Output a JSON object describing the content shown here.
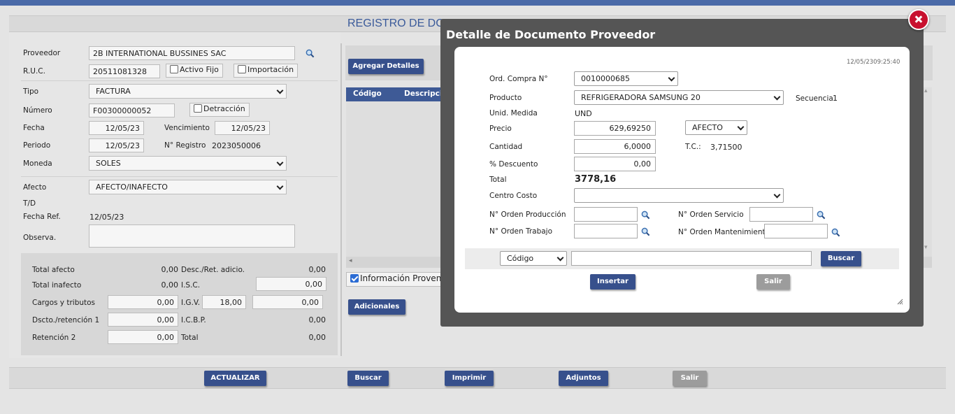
{
  "page": {
    "title": "REGISTRO DE DOCUMENTOS PROVEEDOR",
    "title_visible": "REGISTRO DE DC"
  },
  "form": {
    "proveedor_label": "Proveedor",
    "proveedor_value": "2B INTERNATIONAL BUSSINES SAC",
    "ruc_label": "R.U.C.",
    "ruc_value": "20511081328",
    "activo_fijo_label": "Activo Fijo",
    "importacion_label": "Importación",
    "tipo_label": "Tipo",
    "tipo_value": "FACTURA",
    "numero_label": "Número",
    "numero_value": "F00300000052",
    "detraccion_label": "Detracción",
    "fecha_label": "Fecha",
    "fecha_value": "12/05/23",
    "vencimiento_label": "Vencimiento",
    "vencimiento_value": "12/05/23",
    "periodo_label": "Periodo",
    "periodo_value": "12/05/23",
    "nregistro_label": "N° Registro",
    "nregistro_value": "2023050006",
    "moneda_label": "Moneda",
    "moneda_value": "SOLES",
    "afecto_label": "Afecto",
    "afecto_value": "AFECTO/INAFECTO",
    "td_label": "T/D",
    "fecha_ref_label": "Fecha Ref.",
    "fecha_ref_value": "12/05/23",
    "observa_label": "Observa."
  },
  "totals": {
    "total_afecto_label": "Total afecto",
    "total_afecto_value": "0,00",
    "desc_ret_label": "Desc./Ret. adicio.",
    "desc_ret_value": "0,00",
    "total_inafecto_label": "Total inafecto",
    "total_inafecto_value": "0,00",
    "isc_label": "I.S.C.",
    "isc_value": "0,00",
    "cargos_label": "Cargos y tributos",
    "cargos_value": "0,00",
    "igv_label": "I.G.V.",
    "igv_rate": "18,00",
    "igv_value": "0,00",
    "dscto_label": "Dscto./retención 1",
    "dscto_value": "0,00",
    "icbp_label": "I.C.B.P.",
    "icbp_value": "0,00",
    "retencion2_label": "Retención 2",
    "retencion2_value": "0,00",
    "total_label": "Total",
    "total_value": "0,00"
  },
  "detail": {
    "agregar_label": "Agregar Detalles",
    "col_codigo": "Código",
    "col_descripcion": "Descripció",
    "info_label": "Información Provenie",
    "adicionales_label": "Adicionales"
  },
  "bottom": {
    "actualizar": "ACTUALIZAR",
    "buscar": "Buscar",
    "imprimir": "Imprimir",
    "adjuntos": "Adjuntos",
    "salir": "Salir"
  },
  "modal": {
    "title": "Detalle de Documento Proveedor",
    "timestamp": "12/05/2309:25:40",
    "ord_compra_label": "Ord. Compra N°",
    "ord_compra_value": "0010000685",
    "producto_label": "Producto",
    "producto_value": "REFRIGERADORA SAMSUNG 20",
    "secuencia_label": "Secuencia",
    "secuencia_value": "1",
    "unid_medida_label": "Unid. Medida",
    "unid_medida_value": "UND",
    "precio_label": "Precio",
    "precio_value": "629,69250",
    "afecto_value": "AFECTO",
    "cantidad_label": "Cantidad",
    "cantidad_value": "6,0000",
    "tc_label": "T.C.:",
    "tc_value": "3,71500",
    "descuento_label": "% Descuento",
    "descuento_value": "0,00",
    "total_label": "Total",
    "total_value": "3778,16",
    "centro_costo_label": "Centro Costo",
    "orden_produccion_label": "N° Orden Producción",
    "orden_servicio_label": "N° Orden Servicio",
    "orden_trabajo_label": "N° Orden Trabajo",
    "orden_mantenimiento_label": "N° Orden Mantenimiento",
    "search_field": "Código",
    "buscar": "Buscar",
    "insertar": "Insertar",
    "salir": "Salir"
  },
  "colors": {
    "accent": "#37508c",
    "header_blue": "#4a6aa8",
    "close_red": "#c8102e",
    "modal_frame": "#555555"
  }
}
